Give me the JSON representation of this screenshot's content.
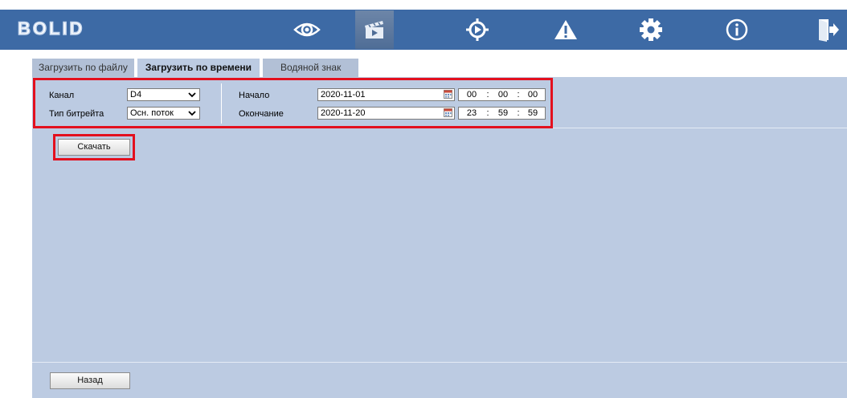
{
  "brand": {
    "logo_text": "BOLID"
  },
  "nav": {
    "items": [
      {
        "name": "preview",
        "icon": "eye-icon"
      },
      {
        "name": "playback",
        "icon": "clapperboard-icon",
        "active": true
      },
      {
        "name": "ptz",
        "icon": "target-play-icon"
      },
      {
        "name": "alarm",
        "icon": "warning-icon"
      },
      {
        "name": "settings",
        "icon": "gear-icon"
      },
      {
        "name": "info",
        "icon": "info-icon"
      },
      {
        "name": "logout",
        "icon": "exit-icon"
      }
    ]
  },
  "tabs": [
    {
      "label": "Загрузить по файлу"
    },
    {
      "label": "Загрузить по времени",
      "active": true
    },
    {
      "label": "Водяной знак"
    }
  ],
  "form": {
    "channel_label": "Канал",
    "channel_value": "D4",
    "bitrate_label": "Тип битрейта",
    "bitrate_value": "Осн. поток",
    "start_label": "Начало",
    "start_date": "2020-11-01",
    "start_time": {
      "h": "00",
      "m": "00",
      "s": "00"
    },
    "end_label": "Окончание",
    "end_date": "2020-11-20",
    "end_time": {
      "h": "23",
      "m": "59",
      "s": "59"
    },
    "time_sep": ":"
  },
  "actions": {
    "download_label": "Скачать",
    "back_label": "Назад"
  },
  "colors": {
    "header_bg": "#3d6aa5",
    "panel_bg": "#bccbe2",
    "highlight": "#e3101e"
  }
}
